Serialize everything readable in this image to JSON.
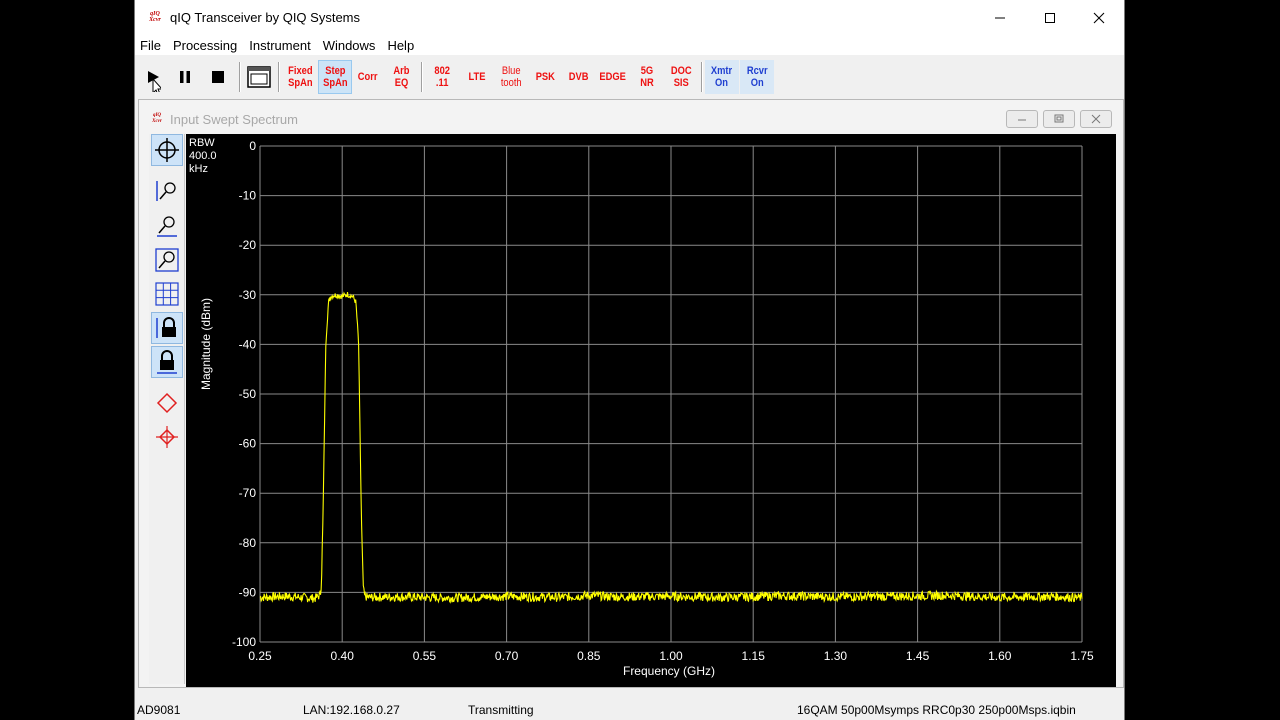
{
  "window": {
    "title": "qIQ Transceiver by QIQ Systems",
    "logo_text": "qIQ Xcvr"
  },
  "menu": [
    "File",
    "Processing",
    "Instrument",
    "Windows",
    "Help"
  ],
  "toolbar": {
    "buttons": [
      {
        "label": "Fixed\nSpAn",
        "color": "#ee1111"
      },
      {
        "label": "Step\nSpAn",
        "color": "#ee1111"
      },
      {
        "label": "Corr",
        "color": "#ee1111"
      },
      {
        "label": "Arb\nEQ",
        "color": "#ee1111"
      },
      {
        "label": "802\n.11",
        "color": "#ee1111"
      },
      {
        "label": "LTE",
        "color": "#ee1111"
      },
      {
        "label": "Blue\ntooth",
        "color": "#ee1111"
      },
      {
        "label": "PSK",
        "color": "#ee1111"
      },
      {
        "label": "DVB",
        "color": "#ee1111"
      },
      {
        "label": "EDGE",
        "color": "#ee1111"
      },
      {
        "label": "5G\nNR",
        "color": "#ee1111"
      },
      {
        "label": "DOC\nSIS",
        "color": "#ee1111"
      },
      {
        "label": "Xmtr\nOn",
        "color": "#1f3fd0"
      },
      {
        "label": "Rcvr\nOn",
        "color": "#1f3fd0"
      }
    ]
  },
  "child_window": {
    "title": "Input Swept Spectrum",
    "logo_text": "qIQ Xcvr"
  },
  "rbw": "RBW\n400.0\nkHz",
  "chart_data": {
    "type": "line",
    "xlabel": "Frequency (GHz)",
    "ylabel": "Magnitude (dBm)",
    "xlim": [
      0.25,
      1.75
    ],
    "ylim": [
      -100,
      0
    ],
    "xticks": [
      0.25,
      0.4,
      0.55,
      0.7,
      0.85,
      1.0,
      1.15,
      1.3,
      1.45,
      1.6,
      1.75
    ],
    "xtick_labels": [
      "0.25",
      "0.40",
      "0.55",
      "0.70",
      "0.85",
      "1.00",
      "1.15",
      "1.30",
      "1.45",
      "1.60",
      "1.75"
    ],
    "yticks": [
      0,
      -10,
      -20,
      -30,
      -40,
      -50,
      -60,
      -70,
      -80,
      -90,
      -100
    ],
    "ytick_labels": [
      "0",
      "-10",
      "-20",
      "-30",
      "-40",
      "-50",
      "-60",
      "-70",
      "-80",
      "-90",
      "-100"
    ],
    "grid": true,
    "trace_color": "#ffff00",
    "series": [
      {
        "x": [
          0.25,
          0.3,
          0.35,
          0.36,
          0.362,
          0.365,
          0.37,
          0.375,
          0.38,
          0.39,
          0.4,
          0.41,
          0.42,
          0.425,
          0.43,
          0.435,
          0.438,
          0.44,
          0.445,
          0.5,
          0.6,
          0.7,
          0.8,
          0.85,
          0.9,
          1.0,
          1.1,
          1.2,
          1.3,
          1.4,
          1.5,
          1.6,
          1.7,
          1.75
        ],
        "y": [
          -91.0,
          -90.8,
          -91.2,
          -90.5,
          -88,
          -75,
          -40,
          -31.5,
          -30.2,
          -30.0,
          -30.3,
          -29.9,
          -30.4,
          -31.5,
          -40,
          -75,
          -88,
          -90.5,
          -91.0,
          -90.9,
          -91.1,
          -90.8,
          -91.0,
          -90.6,
          -90.9,
          -90.8,
          -91.0,
          -90.7,
          -90.9,
          -90.8,
          -90.6,
          -91.0,
          -90.8,
          -91.1
        ]
      }
    ]
  },
  "status": {
    "device": "AD9081",
    "lan": "LAN:192.168.0.27",
    "state": "Transmitting",
    "file": "16QAM 50p00Msymps RRC0p30 250p00Msps.iqbin"
  }
}
